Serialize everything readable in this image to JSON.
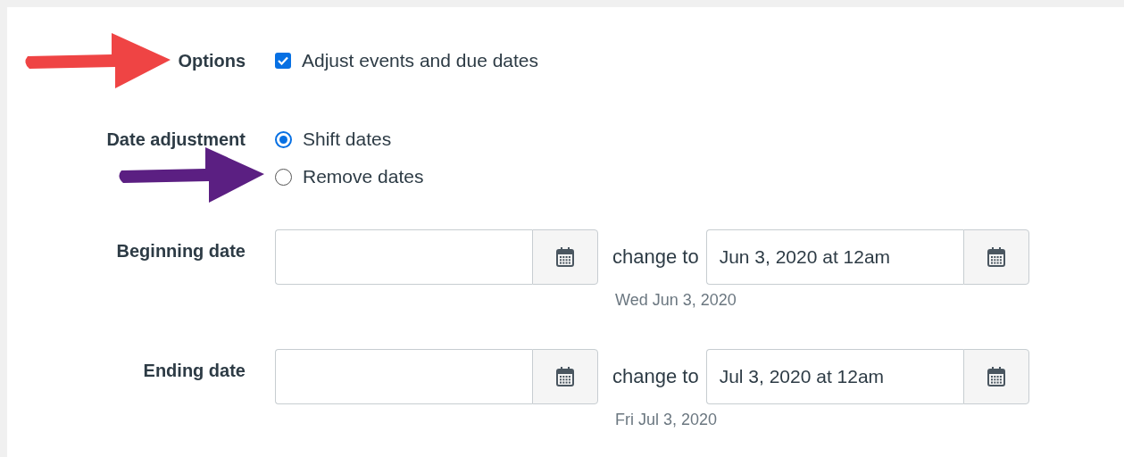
{
  "options": {
    "label": "Options",
    "arrow": {
      "color": "#ef4444"
    },
    "checkbox": {
      "label": "Adjust events and due dates",
      "checked": true
    }
  },
  "date_adjustment": {
    "label": "Date adjustment",
    "choices": [
      {
        "label": "Shift dates",
        "selected": true
      },
      {
        "label": "Remove dates",
        "selected": false,
        "arrow": {
          "color": "#5b1f82"
        }
      }
    ]
  },
  "date_rows": [
    {
      "label": "Beginning date",
      "change_label": "change to",
      "new_value": "Jun 3, 2020 at 12am",
      "hint": "Wed Jun 3, 2020"
    },
    {
      "label": "Ending date",
      "change_label": "change to",
      "new_value": "Jul 3, 2020 at 12am",
      "hint": "Fri Jul 3, 2020"
    }
  ]
}
